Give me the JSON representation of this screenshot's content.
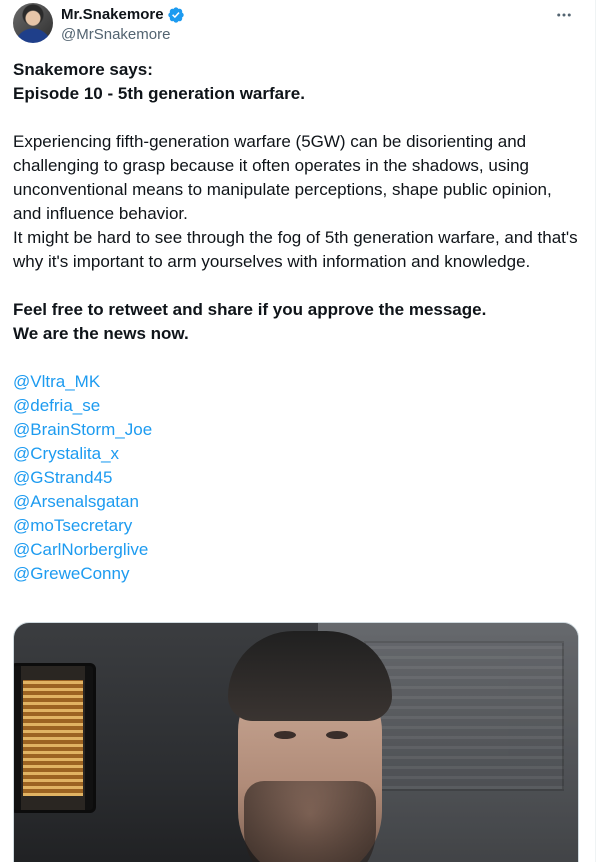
{
  "author": {
    "display_name": "Mr.Snakemore",
    "handle": "@MrSnakemore",
    "verified_color": "#1d9bf0"
  },
  "more_icon": "more-horizontal-icon",
  "tweet": {
    "title_line1": "Snakemore says:",
    "title_line2": "Episode 10 - 5th generation warfare.",
    "paragraph1": "Experiencing fifth-generation warfare (5GW) can be disorienting and challenging to grasp because it often operates in the shadows, using unconventional means to manipulate perceptions, shape public opinion, and influence behavior.",
    "paragraph2": "It might be hard to see through the fog of 5th generation warfare, and that's why it's important to arm yourselves with information and knowledge.",
    "cta_line1": "Feel free to retweet and share if you approve the message.",
    "cta_line2": "We are the news now.",
    "mentions": [
      "@Vltra_MK",
      "@defria_se",
      "@BrainStorm_Joe",
      "@Crystalita_x",
      "@GStrand45",
      "@Arsenalsgatan",
      "@moTsecretary",
      "@CarlNorberglive",
      "@GreweConny"
    ]
  },
  "colors": {
    "text": "#0f1419",
    "secondary": "#536471",
    "link": "#1d9bf0",
    "border": "#cfd9de"
  }
}
